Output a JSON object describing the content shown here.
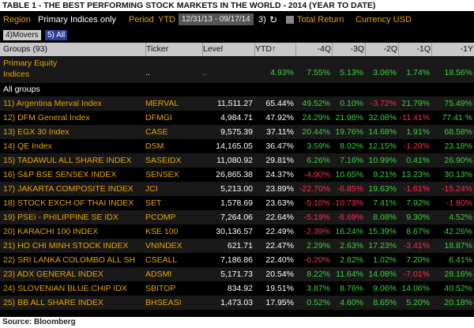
{
  "title": "TABLE 1 - THE BEST PERFORMING STOCK MARKETS IN THE WORLD - 2014 (YEAR TO DATE)",
  "filters": {
    "region_label": "Region",
    "region_value": "Primary Indices only",
    "period_label": "Period",
    "period_value": "YTD",
    "date_range": "12/31/13 - 09/17/14",
    "option_number": "3)",
    "refresh_icon": "refresh-icon",
    "total_return_label": "Total Return",
    "currency_label": "Currency USD"
  },
  "tabs": {
    "movers": "4)Movers",
    "all": "5) All"
  },
  "columns": {
    "group": "Groups (93)",
    "ticker": "Ticker",
    "level": "Level",
    "ytd": "YTD↑",
    "q4": "-4Q",
    "q3": "-3Q",
    "q2": "-2Q",
    "q1": "-1Q",
    "y1": "-1Y"
  },
  "primary_equity": {
    "name_line1": "Primary Equity",
    "name_line2": "Indices",
    "ticker": "..",
    "level": "..",
    "ytd": "4.93%",
    "q4": "7.55%",
    "q3": "5.13%",
    "q2": "3.06%",
    "q1": "1.74%",
    "y1": "18.56%"
  },
  "all_groups_label": "All groups",
  "rows": [
    {
      "name": "11) Argentina Merval Index",
      "ticker": "MERVAL",
      "level": "11,511.27",
      "ytd": "65.44%",
      "q4": "49.52%",
      "q3": "0.10%",
      "q2": "-3.72%",
      "q1": "21.79%",
      "y1": "75.49%"
    },
    {
      "name": "12) DFM General Index",
      "ticker": "DFMGI",
      "level": "4,984.71",
      "ytd": "47.92%",
      "q4": "24.29%",
      "q3": "21.98%",
      "q2": "32.08%",
      "q1": "-11.41%",
      "y1": "77.41 %"
    },
    {
      "name": "13) EGX 30 Index",
      "ticker": "CASE",
      "level": "9,575.39",
      "ytd": "37.11%",
      "q4": "20.44%",
      "q3": "19.76%",
      "q2": "14.68%",
      "q1": "1.91%",
      "y1": "68.58%"
    },
    {
      "name": "14) QE Index",
      "ticker": "DSM",
      "level": "14,165.05",
      "ytd": "36.47%",
      "q4": "3.59%",
      "q3": "8.02%",
      "q2": "12.15%",
      "q1": "-1.29%",
      "y1": "23.18%"
    },
    {
      "name": "15) TADAWUL ALL SHARE INDEX",
      "ticker": "SASEIDX",
      "level": "11,080.92",
      "ytd": "29.81%",
      "q4": "6.26%",
      "q3": "7.16%",
      "q2": "10.99%",
      "q1": "0.41%",
      "y1": "26.90%"
    },
    {
      "name": "16) S&P BSE SENSEX INDEX",
      "ticker": "SENSEX",
      "level": "26,865.38",
      "ytd": "24.37%",
      "q4": "-4.90%",
      "q3": "10.65%",
      "q2": "9.21%",
      "q1": "13.23%",
      "y1": "30.13%"
    },
    {
      "name": "17) JAKARTA COMPOSITE INDEX",
      "ticker": "JCI",
      "level": "5,213.00",
      "ytd": "23.89%",
      "q4": "-22.70%",
      "q3": "-6.85%",
      "q2": "19.63%",
      "q1": "-1.61%",
      "y1": "-15.24%"
    },
    {
      "name": "18) STOCK EXCH OF THAI INDEX",
      "ticker": "SET",
      "level": "1,578.69",
      "ytd": "23.63%",
      "q4": "-5.10%",
      "q3": "-10.73%",
      "q2": "7.41%",
      "q1": "7.92%",
      "y1": "-1.80%"
    },
    {
      "name": "19) PSEi - PHILIPPINE SE IDX",
      "ticker": "PCOMP",
      "level": "7,264.06",
      "ytd": "22.64%",
      "q4": "-5.19%",
      "q3": "-6.69%",
      "q2": "8.08%",
      "q1": "9.30%",
      "y1": "4.52%"
    },
    {
      "name": "20) KARACHI 100 INDEX",
      "ticker": "KSE 100",
      "level": "30,136.57",
      "ytd": "22.49%",
      "q4": "-2.39%",
      "q3": "16.24%",
      "q2": "15.39%",
      "q1": "8.67%",
      "y1": "42.26%"
    },
    {
      "name": "21) HO CHI MINH STOCK INDEX",
      "ticker": "VNINDEX",
      "level": "621.71",
      "ytd": "22.47%",
      "q4": "2.29%",
      "q3": "2.63%",
      "q2": "17.23%",
      "q1": "-3.41%",
      "y1": "18.87%"
    },
    {
      "name": "22) SRI LANKA COLOMBO ALL SH",
      "ticker": "CSEALL",
      "level": "7,186.86",
      "ytd": "22.40%",
      "q4": "-6.20%",
      "q3": "2.82%",
      "q2": "1.02%",
      "q1": "7.20%",
      "y1": "6.41%"
    },
    {
      "name": "23) ADX GENERAL INDEX",
      "ticker": "ADSMI",
      "level": "5,171.73",
      "ytd": "20.54%",
      "q4": "8.22%",
      "q3": "11.64%",
      "q2": "14.08%",
      "q1": "-7.01%",
      "y1": "28.16%"
    },
    {
      "name": "24) SLOVENIAN BLUE CHIP IDX",
      "ticker": "SBITOP",
      "level": "834.92",
      "ytd": "19.51%",
      "q4": "3.87%",
      "q3": "8.76%",
      "q2": "9.06%",
      "q1": "14.06%",
      "y1": "40.52%"
    },
    {
      "name": "25) BB ALL SHARE INDEX",
      "ticker": "BHSEASI",
      "level": "1,473.03",
      "ytd": "17.95%",
      "q4": "0.52%",
      "q3": "4.60%",
      "q2": "8.65%",
      "q1": "5.20%",
      "y1": "20.18%"
    }
  ],
  "footer": "Source: Bloomberg",
  "colors": {
    "panel_bg": "#000000",
    "label_amber": "#e6a400",
    "positive_green": "#39d33a",
    "negative_red": "#ff2d55",
    "header_gray": "#c8c8c8",
    "tab_blue": "#2b3f9a"
  }
}
